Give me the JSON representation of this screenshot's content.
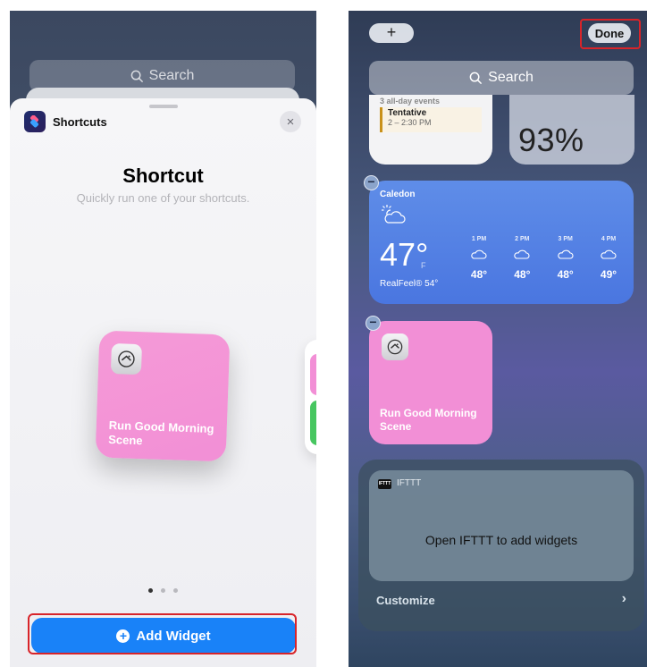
{
  "left": {
    "search_placeholder": "Search",
    "app_name": "Shortcuts",
    "close_glyph": "×",
    "widget_title": "Shortcut",
    "widget_subtitle": "Quickly run one of your shortcuts.",
    "preview_label": "Run Good Morning Scene",
    "page_dots": 3,
    "active_dot": 0,
    "add_widget_label": "Add Widget",
    "add_widget_icon": "plus-circle-icon",
    "accent_color": "#1982f8",
    "highlight_color": "#d8242a"
  },
  "right": {
    "add_button_glyph": "+",
    "done_label": "Done",
    "search_placeholder": "Search",
    "calendar": {
      "all_day": "3 all-day events",
      "event_title": "Tentative",
      "event_time": "2 – 2:30 PM"
    },
    "battery": {
      "percent": "93%"
    },
    "weather": {
      "city": "Caledon",
      "temp": "47°",
      "unit": "F",
      "real_feel": "RealFeel® 54°",
      "hourly": [
        {
          "time": "1 PM",
          "temp": "48°"
        },
        {
          "time": "2 PM",
          "temp": "48°"
        },
        {
          "time": "3 PM",
          "temp": "48°"
        },
        {
          "time": "4 PM",
          "temp": "49°"
        }
      ]
    },
    "shortcut_label": "Run Good Morning Scene",
    "ifttt": {
      "logo_text": "IFTTT",
      "name": "IFTTT",
      "message": "Open IFTTT to add widgets",
      "customize": "Customize",
      "chevron": "›"
    }
  }
}
